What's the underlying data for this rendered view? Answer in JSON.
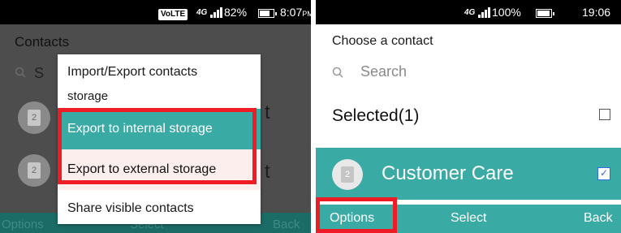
{
  "left_screen": {
    "status": {
      "volte": "VoLTE",
      "network": "4G",
      "battery": "82%",
      "time": "8:07",
      "time_suffix": "PM",
      "battery_level": 0.82
    },
    "background": {
      "title": "Contacts",
      "search_fragment": "S",
      "row_trailing_fragment": "t",
      "softkeys": {
        "left": "Options",
        "center": "Select",
        "right": "Back"
      }
    },
    "menu": {
      "title": "Import/Export contacts",
      "fragment": "storage",
      "items": [
        {
          "label": "Export to internal storage"
        },
        {
          "label": "Export to external storage"
        },
        {
          "label": "Share visible contacts"
        }
      ]
    },
    "colors": {
      "accent": "#3aaaa5",
      "highlight_border": "#ee1c25"
    }
  },
  "right_screen": {
    "status": {
      "network": "4G",
      "battery": "100%",
      "time": "19:06",
      "battery_level": 1.0
    },
    "title": "Choose a contact",
    "search_placeholder": "Search",
    "selected_label": "Selected(1)",
    "contact": {
      "name": "Customer Care",
      "sim_slot": "2",
      "checked": true
    },
    "softkeys": {
      "left": "Options",
      "center": "Select",
      "right": "Back"
    },
    "colors": {
      "accent": "#3aaaa5",
      "highlight_border": "#ee1c25",
      "checkbox": "#2d6de6"
    }
  },
  "icons": [
    "signal-icon",
    "battery-icon",
    "search-icon",
    "sim-icon",
    "checkbox-icon"
  ]
}
